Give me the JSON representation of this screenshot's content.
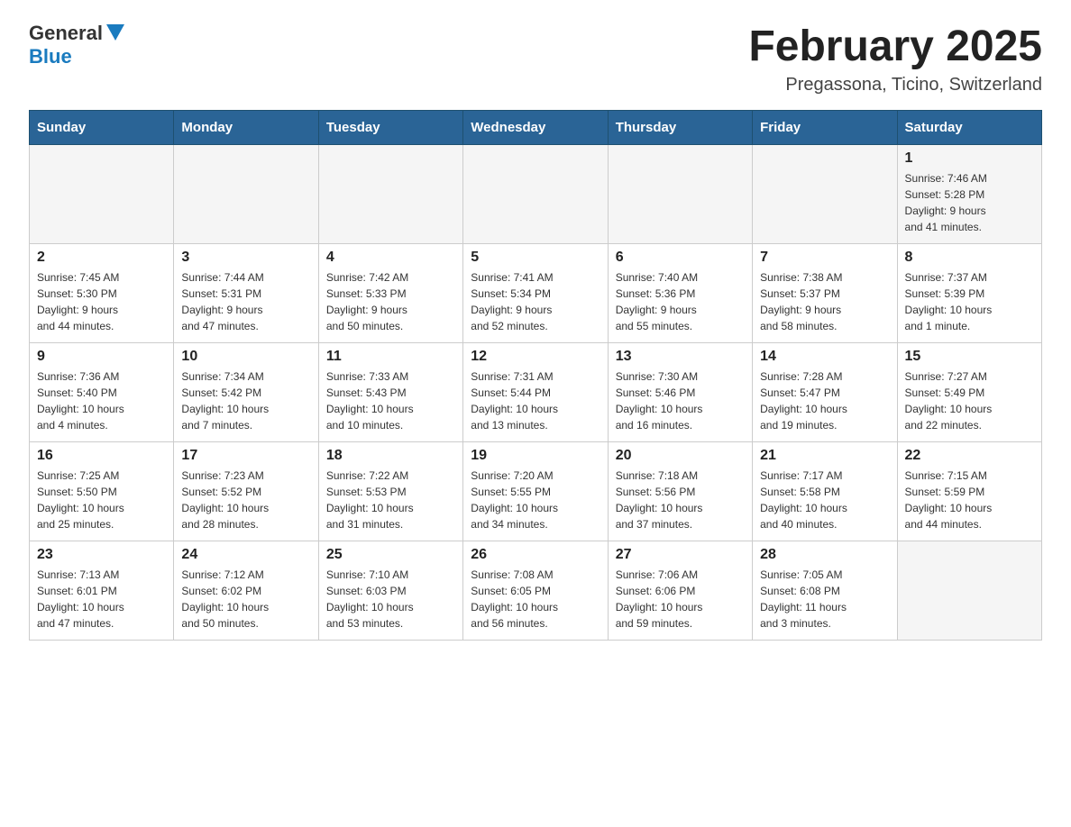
{
  "header": {
    "logo_general": "General",
    "logo_blue": "Blue",
    "month_title": "February 2025",
    "location": "Pregassona, Ticino, Switzerland"
  },
  "days_of_week": [
    "Sunday",
    "Monday",
    "Tuesday",
    "Wednesday",
    "Thursday",
    "Friday",
    "Saturday"
  ],
  "weeks": [
    [
      {
        "day": "",
        "info": ""
      },
      {
        "day": "",
        "info": ""
      },
      {
        "day": "",
        "info": ""
      },
      {
        "day": "",
        "info": ""
      },
      {
        "day": "",
        "info": ""
      },
      {
        "day": "",
        "info": ""
      },
      {
        "day": "1",
        "info": "Sunrise: 7:46 AM\nSunset: 5:28 PM\nDaylight: 9 hours\nand 41 minutes."
      }
    ],
    [
      {
        "day": "2",
        "info": "Sunrise: 7:45 AM\nSunset: 5:30 PM\nDaylight: 9 hours\nand 44 minutes."
      },
      {
        "day": "3",
        "info": "Sunrise: 7:44 AM\nSunset: 5:31 PM\nDaylight: 9 hours\nand 47 minutes."
      },
      {
        "day": "4",
        "info": "Sunrise: 7:42 AM\nSunset: 5:33 PM\nDaylight: 9 hours\nand 50 minutes."
      },
      {
        "day": "5",
        "info": "Sunrise: 7:41 AM\nSunset: 5:34 PM\nDaylight: 9 hours\nand 52 minutes."
      },
      {
        "day": "6",
        "info": "Sunrise: 7:40 AM\nSunset: 5:36 PM\nDaylight: 9 hours\nand 55 minutes."
      },
      {
        "day": "7",
        "info": "Sunrise: 7:38 AM\nSunset: 5:37 PM\nDaylight: 9 hours\nand 58 minutes."
      },
      {
        "day": "8",
        "info": "Sunrise: 7:37 AM\nSunset: 5:39 PM\nDaylight: 10 hours\nand 1 minute."
      }
    ],
    [
      {
        "day": "9",
        "info": "Sunrise: 7:36 AM\nSunset: 5:40 PM\nDaylight: 10 hours\nand 4 minutes."
      },
      {
        "day": "10",
        "info": "Sunrise: 7:34 AM\nSunset: 5:42 PM\nDaylight: 10 hours\nand 7 minutes."
      },
      {
        "day": "11",
        "info": "Sunrise: 7:33 AM\nSunset: 5:43 PM\nDaylight: 10 hours\nand 10 minutes."
      },
      {
        "day": "12",
        "info": "Sunrise: 7:31 AM\nSunset: 5:44 PM\nDaylight: 10 hours\nand 13 minutes."
      },
      {
        "day": "13",
        "info": "Sunrise: 7:30 AM\nSunset: 5:46 PM\nDaylight: 10 hours\nand 16 minutes."
      },
      {
        "day": "14",
        "info": "Sunrise: 7:28 AM\nSunset: 5:47 PM\nDaylight: 10 hours\nand 19 minutes."
      },
      {
        "day": "15",
        "info": "Sunrise: 7:27 AM\nSunset: 5:49 PM\nDaylight: 10 hours\nand 22 minutes."
      }
    ],
    [
      {
        "day": "16",
        "info": "Sunrise: 7:25 AM\nSunset: 5:50 PM\nDaylight: 10 hours\nand 25 minutes."
      },
      {
        "day": "17",
        "info": "Sunrise: 7:23 AM\nSunset: 5:52 PM\nDaylight: 10 hours\nand 28 minutes."
      },
      {
        "day": "18",
        "info": "Sunrise: 7:22 AM\nSunset: 5:53 PM\nDaylight: 10 hours\nand 31 minutes."
      },
      {
        "day": "19",
        "info": "Sunrise: 7:20 AM\nSunset: 5:55 PM\nDaylight: 10 hours\nand 34 minutes."
      },
      {
        "day": "20",
        "info": "Sunrise: 7:18 AM\nSunset: 5:56 PM\nDaylight: 10 hours\nand 37 minutes."
      },
      {
        "day": "21",
        "info": "Sunrise: 7:17 AM\nSunset: 5:58 PM\nDaylight: 10 hours\nand 40 minutes."
      },
      {
        "day": "22",
        "info": "Sunrise: 7:15 AM\nSunset: 5:59 PM\nDaylight: 10 hours\nand 44 minutes."
      }
    ],
    [
      {
        "day": "23",
        "info": "Sunrise: 7:13 AM\nSunset: 6:01 PM\nDaylight: 10 hours\nand 47 minutes."
      },
      {
        "day": "24",
        "info": "Sunrise: 7:12 AM\nSunset: 6:02 PM\nDaylight: 10 hours\nand 50 minutes."
      },
      {
        "day": "25",
        "info": "Sunrise: 7:10 AM\nSunset: 6:03 PM\nDaylight: 10 hours\nand 53 minutes."
      },
      {
        "day": "26",
        "info": "Sunrise: 7:08 AM\nSunset: 6:05 PM\nDaylight: 10 hours\nand 56 minutes."
      },
      {
        "day": "27",
        "info": "Sunrise: 7:06 AM\nSunset: 6:06 PM\nDaylight: 10 hours\nand 59 minutes."
      },
      {
        "day": "28",
        "info": "Sunrise: 7:05 AM\nSunset: 6:08 PM\nDaylight: 11 hours\nand 3 minutes."
      },
      {
        "day": "",
        "info": ""
      }
    ]
  ]
}
